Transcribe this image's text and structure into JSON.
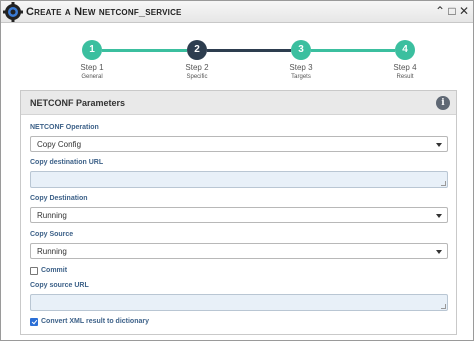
{
  "window": {
    "title": "Create a New netconf_service",
    "controls": {
      "minimize": "⌃",
      "maximize": "□",
      "close": "✕"
    }
  },
  "wizard": {
    "steps": [
      {
        "number": "1",
        "label": "Step 1",
        "sublabel": "General",
        "color": "#3bbf9f"
      },
      {
        "number": "2",
        "label": "Step 2",
        "sublabel": "Specific",
        "color": "#2d3d4f"
      },
      {
        "number": "3",
        "label": "Step 3",
        "sublabel": "Targets",
        "color": "#3bbf9f"
      },
      {
        "number": "4",
        "label": "Step 4",
        "sublabel": "Result",
        "color": "#3bbf9f"
      }
    ]
  },
  "panel": {
    "title": "NETCONF Parameters",
    "info_icon": "i",
    "netconf_operation": {
      "label": "NETCONF Operation",
      "value": "Copy Config"
    },
    "copy_destination_url": {
      "label": "Copy destination URL",
      "value": ""
    },
    "copy_destination": {
      "label": "Copy Destination",
      "value": "Running"
    },
    "copy_source": {
      "label": "Copy Source",
      "value": "Running"
    },
    "commit": {
      "label": "Commit",
      "checked": false
    },
    "copy_source_url": {
      "label": "Copy source URL",
      "value": ""
    },
    "convert_xml": {
      "label": "Convert XML result to dictionary",
      "checked": true
    }
  },
  "colors": {
    "accent": "#3bbf9f",
    "active_step": "#2d3d4f",
    "label_blue": "#3e6289"
  }
}
